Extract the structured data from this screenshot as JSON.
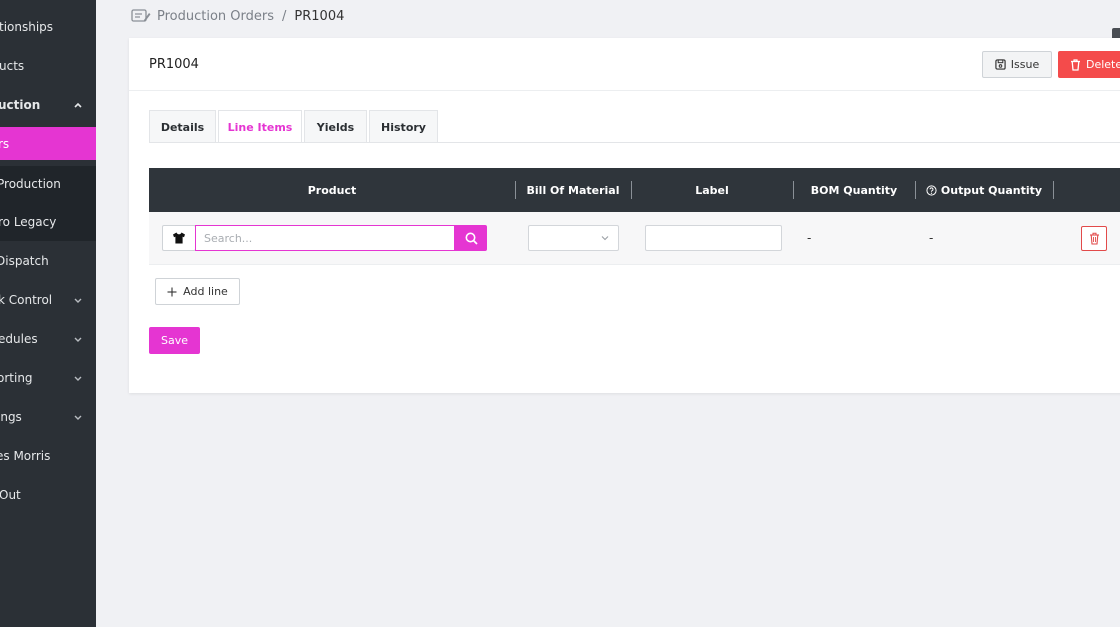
{
  "sidebar": {
    "items": [
      {
        "label": "tionships"
      },
      {
        "label": "ucts"
      },
      {
        "label": "uction"
      },
      {
        "label": "rs"
      },
      {
        "label": "Production"
      },
      {
        "label": "ro Legacy"
      },
      {
        "label": " Dispatch"
      },
      {
        "label": "k Control"
      },
      {
        "label": "edules"
      },
      {
        "label": "orting"
      },
      {
        "label": "ings"
      },
      {
        "label": "es Morris"
      },
      {
        "label": "Out"
      }
    ]
  },
  "breadcrumb": {
    "parent": "Production Orders",
    "separator": "/",
    "current": "PR1004"
  },
  "card": {
    "title": "PR1004",
    "issue_label": "Issue",
    "delete_label": "Delete"
  },
  "tabs": [
    {
      "label": "Details"
    },
    {
      "label": "Line Items"
    },
    {
      "label": "Yields"
    },
    {
      "label": "History"
    }
  ],
  "table": {
    "headers": [
      "Product",
      "Bill Of Material",
      "Label",
      "BOM Quantity",
      "Output Quantity"
    ],
    "row": {
      "search_placeholder": "Search...",
      "bom_quantity": "-",
      "output_quantity": "-"
    }
  },
  "actions": {
    "add_line_label": "Add line",
    "save_label": "Save"
  },
  "colors": {
    "accent": "#e535d2",
    "danger": "#f44b4b",
    "sidebar": "#2b3036",
    "table_header": "#2f353b"
  }
}
